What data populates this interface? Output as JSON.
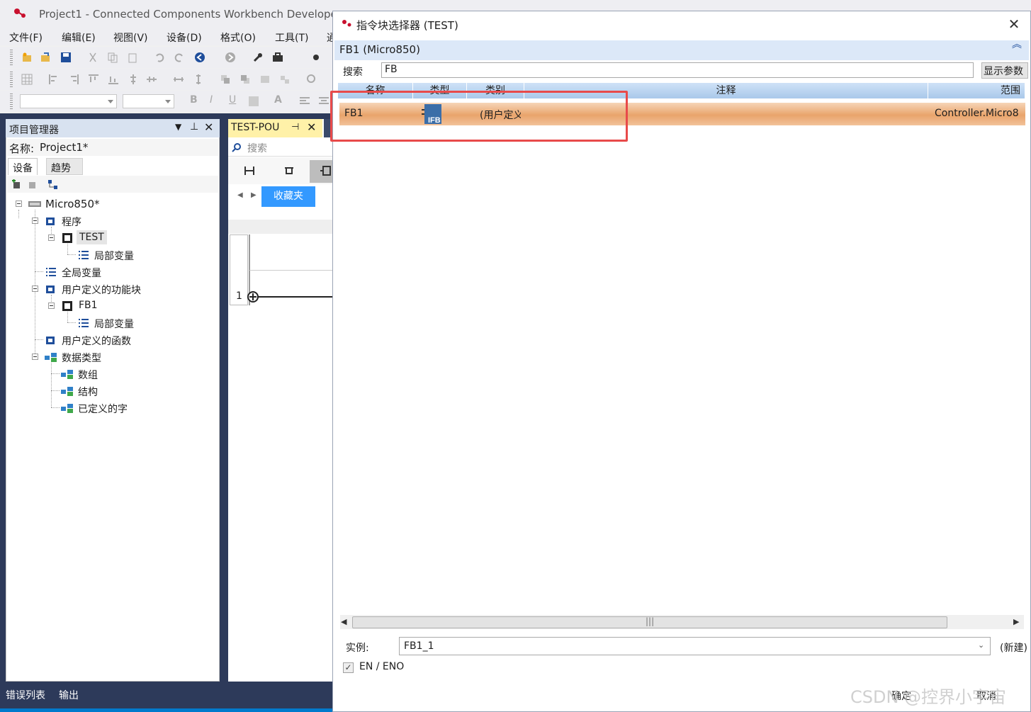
{
  "app": {
    "title": "Project1 - Connected Components Workbench Develope",
    "menu": [
      "文件(F)",
      "编辑(E)",
      "视图(V)",
      "设备(D)",
      "格式(O)",
      "工具(T)",
      "通"
    ]
  },
  "project_manager": {
    "title": "项目管理器",
    "name_label": "名称:",
    "name_value": "Project1*",
    "tabs": [
      "设备",
      "趋势"
    ],
    "tree": {
      "root": "Micro850*",
      "programs": "程序",
      "test": "TEST",
      "test_local": "局部变量",
      "global_vars": "全局变量",
      "udfb": "用户定义的功能块",
      "fb1": "FB1",
      "fb1_local": "局部变量",
      "udf": "用户定义的函数",
      "datatypes": "数据类型",
      "array": "数组",
      "struct": "结构",
      "defined_words": "已定义的字"
    }
  },
  "editor": {
    "tab_label": "TEST-POU",
    "search_placeholder": "搜索",
    "favorites": "收藏夹",
    "rung_number": "1"
  },
  "bottom_tabs": [
    "错误列表",
    "输出"
  ],
  "dialog": {
    "title": "指令块选择器 (TEST)",
    "subtitle": "FB1 (Micro850)",
    "search_label": "搜索",
    "search_value": "FB",
    "show_params": "显示参数",
    "columns": [
      "名称",
      "类型",
      "类别",
      "注释",
      "范围"
    ],
    "rows": [
      {
        "name": "FB1",
        "type_icon": "IFB",
        "category": "(用户定义",
        "comment": "",
        "scope": "Controller.Micro8"
      }
    ],
    "instance_label": "实例:",
    "instance_value": "FB1_1",
    "instance_status": "(新建)",
    "en_eno_label": "EN / ENO",
    "en_eno_checked": true,
    "ok": "确定",
    "cancel": "取消"
  },
  "watermark": "CSDN @控界小宇宙"
}
